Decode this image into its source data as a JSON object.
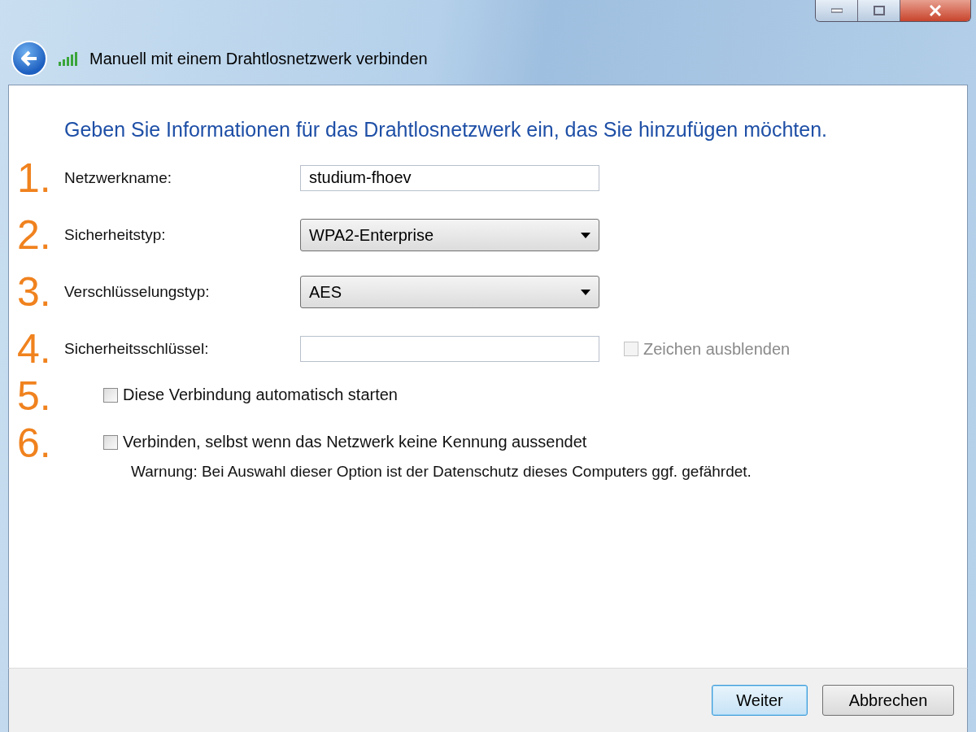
{
  "window": {
    "title": "Manuell mit einem Drahtlosnetzwerk verbinden"
  },
  "heading": "Geben Sie Informationen für das Drahtlosnetzwerk ein, das Sie hinzufügen möchten.",
  "fields": [
    {
      "number": "1.",
      "label": "Netzwerkname:",
      "kind": "text",
      "value": "studium-fhoev"
    },
    {
      "number": "2.",
      "label": "Sicherheitstyp:",
      "kind": "select",
      "value": "WPA2-Enterprise"
    },
    {
      "number": "3.",
      "label": "Verschlüsselungstyp:",
      "kind": "select",
      "value": "AES"
    },
    {
      "number": "4.",
      "label": "Sicherheitsschlüssel:",
      "kind": "text",
      "checkbox": {
        "label": "Zeichen ausblenden",
        "checked": false,
        "disabled": true
      }
    }
  ],
  "options": [
    {
      "number": "5.",
      "label": "Diese Verbindung automatisch starten",
      "checked": false
    },
    {
      "number": "6.",
      "label": "Verbinden, selbst wenn das Netzwerk keine Kennung aussendet",
      "checked": false,
      "note": "Warnung: Bei Auswahl dieser Option ist der Datenschutz dieses Computers ggf. gefährdet."
    }
  ],
  "buttons": [
    {
      "label": "Weiter",
      "default": true
    },
    {
      "label": "Abbrechen",
      "default": false
    }
  ]
}
